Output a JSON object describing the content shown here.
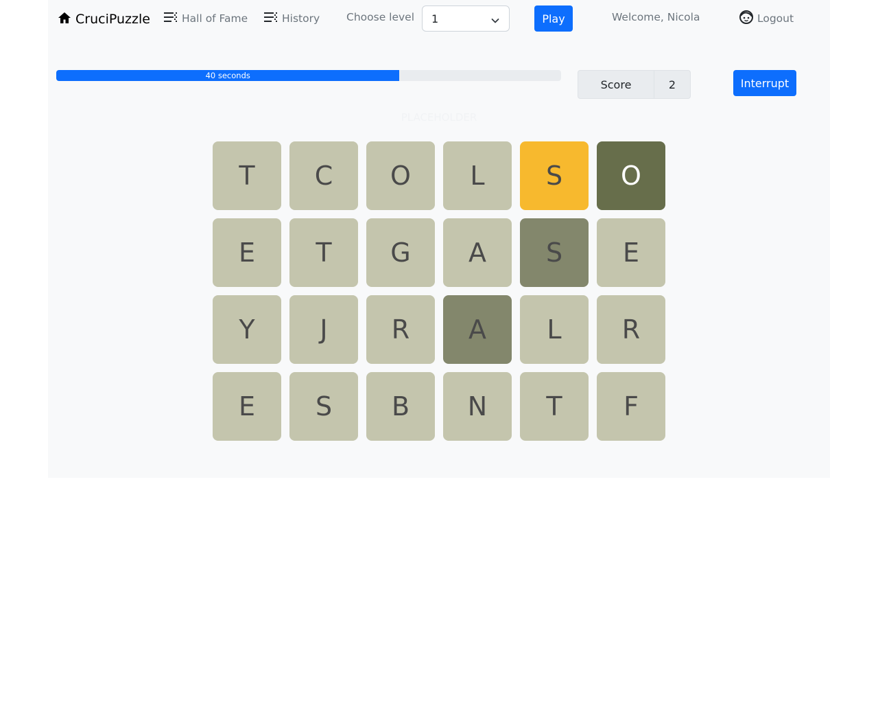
{
  "nav": {
    "brand": "CruciPuzzle",
    "hall_of_fame": "Hall of Fame",
    "history": "History",
    "choose_level": "Choose level",
    "level_selected": "1",
    "play": "Play",
    "welcome": "Welcome, Nicola",
    "logout": "Logout"
  },
  "game": {
    "timer_text": "40 seconds",
    "timer_progress_percent": 68,
    "score_label": "Score",
    "score_value": "2",
    "interrupt": "Interrupt",
    "placeholder": "PLACEHOLDER"
  },
  "colors": {
    "cell_default": "#c4c5ad",
    "cell_selected": "#f7b92e",
    "cell_found_dark": "#676e4b",
    "cell_found": "#83876c",
    "accent": "#0d6efd"
  },
  "grid": [
    [
      {
        "letter": "T",
        "state": "default"
      },
      {
        "letter": "C",
        "state": "default"
      },
      {
        "letter": "O",
        "state": "default"
      },
      {
        "letter": "L",
        "state": "default"
      },
      {
        "letter": "S",
        "state": "selected"
      },
      {
        "letter": "O",
        "state": "found_dark"
      }
    ],
    [
      {
        "letter": "E",
        "state": "default"
      },
      {
        "letter": "T",
        "state": "default"
      },
      {
        "letter": "G",
        "state": "default"
      },
      {
        "letter": "A",
        "state": "default"
      },
      {
        "letter": "S",
        "state": "found"
      },
      {
        "letter": "E",
        "state": "default"
      }
    ],
    [
      {
        "letter": "Y",
        "state": "default"
      },
      {
        "letter": "J",
        "state": "default"
      },
      {
        "letter": "R",
        "state": "default"
      },
      {
        "letter": "A",
        "state": "found"
      },
      {
        "letter": "L",
        "state": "default"
      },
      {
        "letter": "R",
        "state": "default"
      }
    ],
    [
      {
        "letter": "E",
        "state": "default"
      },
      {
        "letter": "S",
        "state": "default"
      },
      {
        "letter": "B",
        "state": "default"
      },
      {
        "letter": "N",
        "state": "default"
      },
      {
        "letter": "T",
        "state": "default"
      },
      {
        "letter": "F",
        "state": "default"
      }
    ]
  ]
}
